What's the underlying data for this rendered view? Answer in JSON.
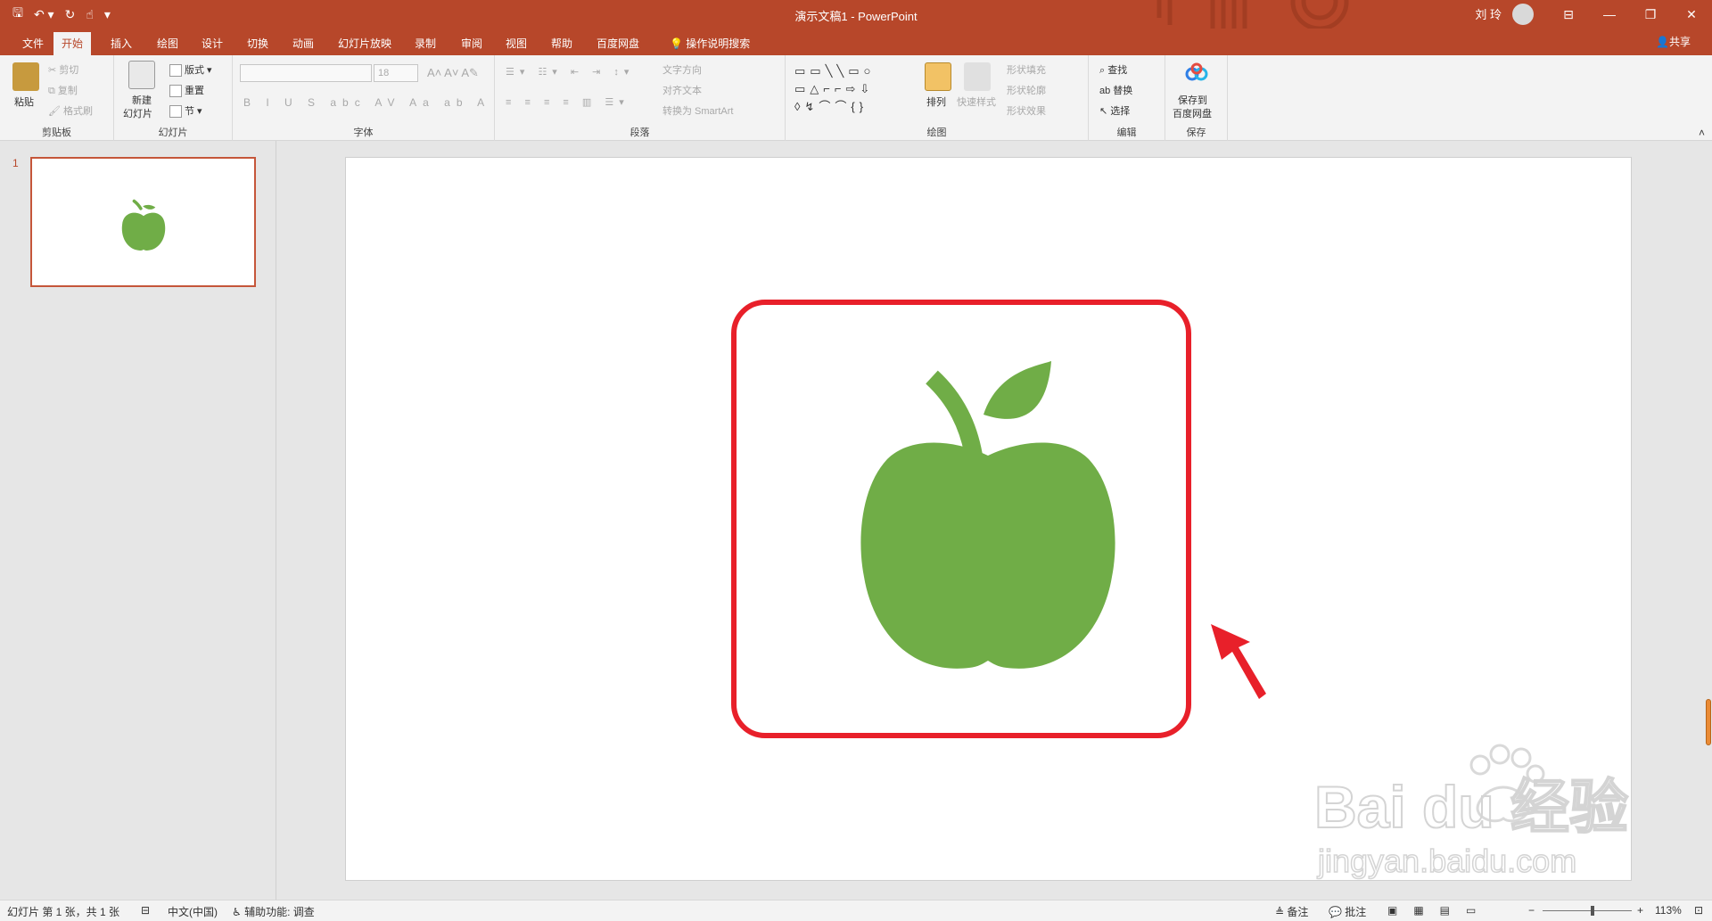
{
  "window": {
    "title": "演示文稿1  -  PowerPoint",
    "user": "刘 玲",
    "accent_color": "#b7472a"
  },
  "tabs": [
    {
      "label": "文件",
      "active": false
    },
    {
      "label": "开始",
      "active": true
    },
    {
      "label": "插入",
      "active": false
    },
    {
      "label": "绘图",
      "active": false
    },
    {
      "label": "设计",
      "active": false
    },
    {
      "label": "切换",
      "active": false
    },
    {
      "label": "动画",
      "active": false
    },
    {
      "label": "幻灯片放映",
      "active": false
    },
    {
      "label": "录制",
      "active": false
    },
    {
      "label": "审阅",
      "active": false
    },
    {
      "label": "视图",
      "active": false
    },
    {
      "label": "帮助",
      "active": false
    },
    {
      "label": "百度网盘",
      "active": false
    },
    {
      "label": "操作说明搜索",
      "active": false
    }
  ],
  "share_label": "共享",
  "ribbon": {
    "clipboard": {
      "paste": "粘贴",
      "cut": "剪切",
      "copy": "复制",
      "format_painter": "格式刷",
      "group": "剪贴板"
    },
    "slides": {
      "new_slide": "新建",
      "new_slide_2": "幻灯片",
      "layout": "版式",
      "reset": "重置",
      "section": "节",
      "group": "幻灯片"
    },
    "font": {
      "font_size": "18",
      "group": "字体"
    },
    "paragraph": {
      "text_direction": "文字方向",
      "align_text": "对齐文本",
      "smartart": "转换为 SmartArt",
      "group": "段落"
    },
    "drawing": {
      "arrange": "排列",
      "quick_styles": "快速样式",
      "shape_fill": "形状填充",
      "shape_outline": "形状轮廓",
      "shape_effects": "形状效果",
      "group": "绘图"
    },
    "editing": {
      "find": "查找",
      "replace": "替换",
      "select": "选择",
      "group": "编辑"
    },
    "save": {
      "save_to": "保存到",
      "baidu": "百度网盘",
      "group": "保存"
    }
  },
  "thumbnails": [
    {
      "number": "1"
    }
  ],
  "slide": {
    "apple_color": "#70ad47",
    "highlight_color": "#e8202a"
  },
  "statusbar": {
    "slide_info": "幻灯片 第 1 张，共 1 张",
    "language": "中文(中国)",
    "accessibility": "辅助功能: 调查",
    "notes": "备注",
    "comments": "批注",
    "zoom": "113%",
    "zoom_level": 0.56
  },
  "watermark": {
    "brand": "Bai du 经验",
    "url": "jingyan.baidu.com"
  }
}
